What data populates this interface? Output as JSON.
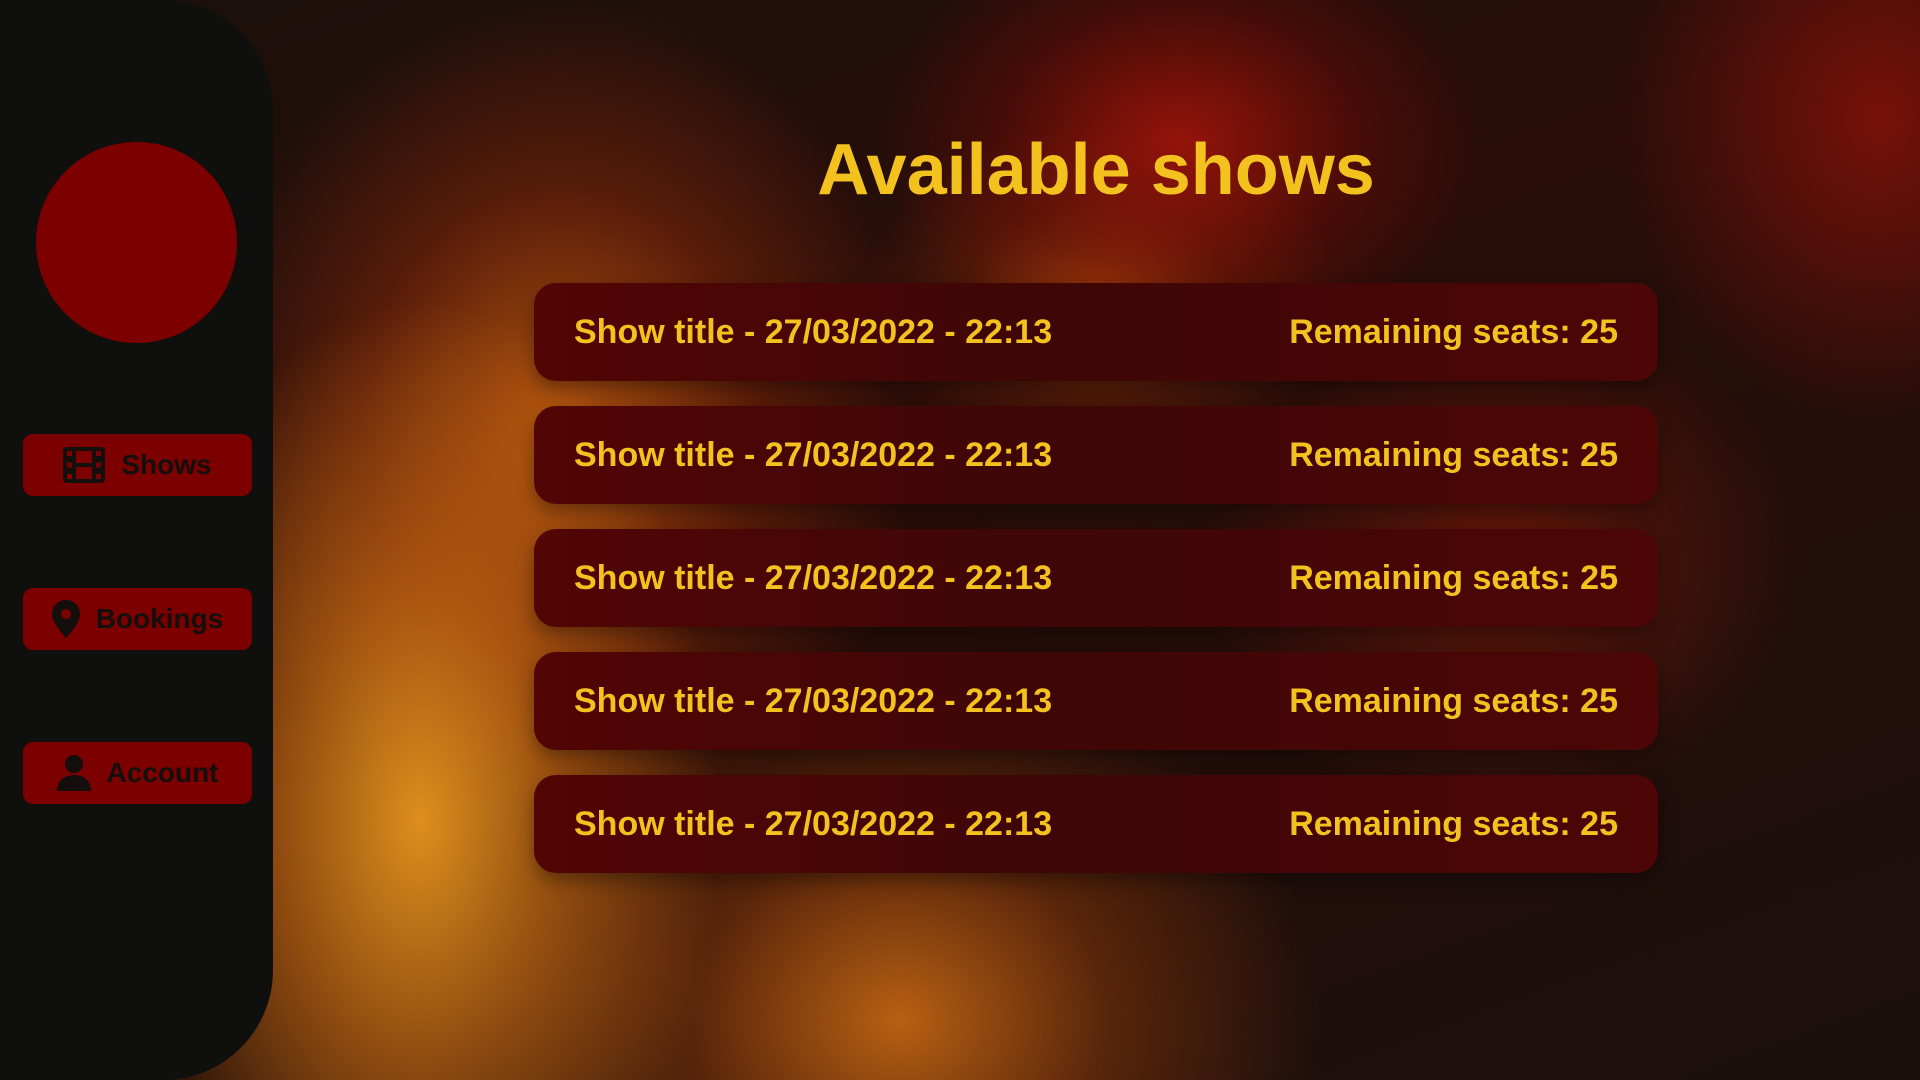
{
  "sidebar": {
    "nav": [
      {
        "label": "Shows",
        "icon": "film-icon"
      },
      {
        "label": "Bookings",
        "icon": "map-pin-icon"
      },
      {
        "label": "Account",
        "icon": "user-icon"
      }
    ]
  },
  "main": {
    "title": "Available shows",
    "shows": [
      {
        "info": "Show title - 27/03/2022 - 22:13",
        "seats": "Remaining seats: 25"
      },
      {
        "info": "Show title - 27/03/2022 - 22:13",
        "seats": "Remaining seats: 25"
      },
      {
        "info": "Show title - 27/03/2022 - 22:13",
        "seats": "Remaining seats: 25"
      },
      {
        "info": "Show title - 27/03/2022 - 22:13",
        "seats": "Remaining seats: 25"
      },
      {
        "info": "Show title - 27/03/2022 - 22:13",
        "seats": "Remaining seats: 25"
      }
    ]
  },
  "colors": {
    "accent": "#f3c21e",
    "brand_red": "#7d0000",
    "sidebar_bg": "#0f0f0e",
    "row_bg": "#4a0606"
  }
}
